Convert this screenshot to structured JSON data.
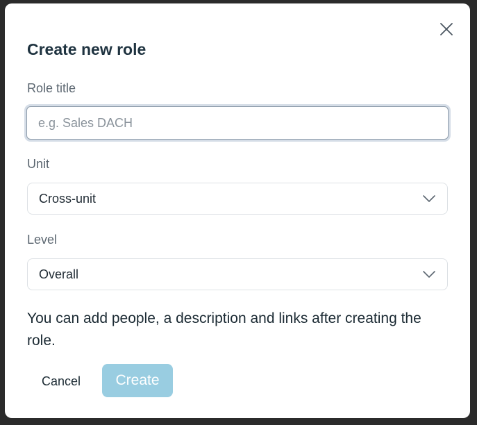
{
  "dialog": {
    "title": "Create new role",
    "close_icon": "close-icon"
  },
  "fields": {
    "role_title": {
      "label": "Role title",
      "value": "",
      "placeholder": "e.g. Sales DACH"
    },
    "unit": {
      "label": "Unit",
      "selected": "Cross-unit",
      "icon": "chevron-down-icon"
    },
    "level": {
      "label": "Level",
      "selected": "Overall",
      "icon": "chevron-down-icon"
    }
  },
  "info_text": "You can add people, a description and links after creating the role.",
  "actions": {
    "cancel_label": "Cancel",
    "create_label": "Create",
    "create_disabled": true
  },
  "colors": {
    "title": "#1f3340",
    "primary_disabled": "#99cde1",
    "input_focus_ring": "#d5dde7"
  }
}
